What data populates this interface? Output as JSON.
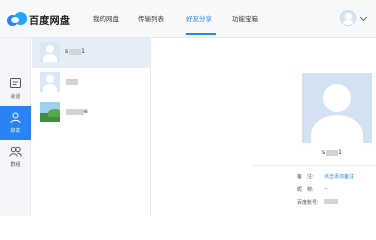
{
  "app": {
    "logo_text": "百度网盘",
    "brand_color": "#2a83f5"
  },
  "nav": {
    "items": [
      "我的网盘",
      "传输列表",
      "好友分享",
      "功能宝箱"
    ],
    "active_index": 2
  },
  "rail": {
    "items": [
      {
        "label": "会话",
        "icon": "chat-icon"
      },
      {
        "label": "好友",
        "icon": "friend-icon"
      },
      {
        "label": "群组",
        "icon": "group-icon"
      }
    ],
    "active_index": 1
  },
  "contacts": [
    {
      "name": "s",
      "tail": "1",
      "avatar": "default-avatar"
    },
    {
      "name": "",
      "tail": "",
      "avatar": "default-avatar"
    },
    {
      "name": "",
      "tail": "e",
      "avatar": "landscape-photo"
    }
  ],
  "profile": {
    "name": "s",
    "name_tail": "1",
    "remark_label": "备　注:",
    "remark_link": "点击添加备注",
    "nickname_label": "昵　称:",
    "nickname_value": "--",
    "account_label": "百度账号:"
  }
}
